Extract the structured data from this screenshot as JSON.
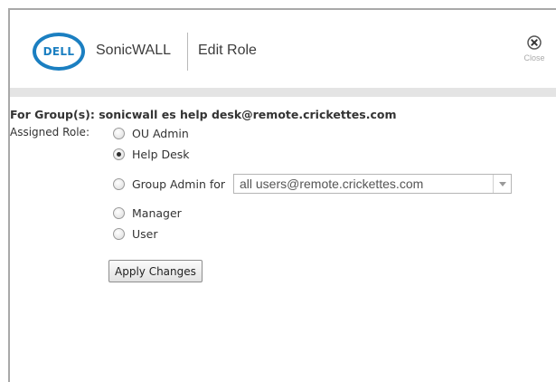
{
  "header": {
    "logo_text": "DELL",
    "brand": "SonicWALL",
    "title": "Edit Role",
    "close_label": "Close"
  },
  "form": {
    "for_group_text": "For Group(s): sonicwall es help desk@remote.crickettes.com",
    "assigned_role_label": "Assigned Role:",
    "roles": [
      {
        "label": "OU Admin",
        "checked": false
      },
      {
        "label": "Help Desk",
        "checked": true
      },
      {
        "label": "Group Admin for",
        "checked": false
      },
      {
        "label": "Manager",
        "checked": false
      },
      {
        "label": "User",
        "checked": false
      }
    ],
    "group_admin_select": {
      "value": "all users@remote.crickettes.com"
    },
    "apply_button": "Apply Changes"
  },
  "colors": {
    "dell_blue": "#1b7fc1",
    "band_gray": "#e4e4e4"
  },
  "icons": {
    "close": "close-circle-x-icon",
    "select_arrow": "chevron-down-icon"
  }
}
